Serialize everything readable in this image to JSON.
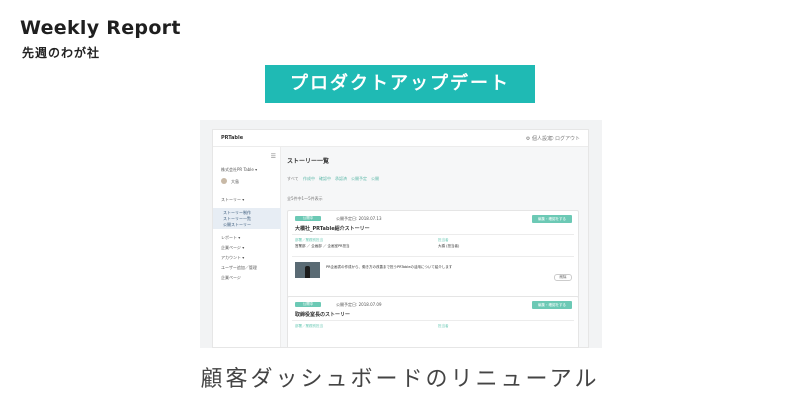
{
  "header": {
    "title": "Weekly Report",
    "subtitle": "先週のわが社"
  },
  "banner": {
    "label": "プロダクトアップデート"
  },
  "caption": "顧客ダッシュボードのリニューアル",
  "screenshot": {
    "topbar": {
      "logo": "PRTable",
      "right_items": [
        "⚙ 個人設定",
        "⎋ ログアウト"
      ]
    },
    "sidebar": {
      "company": "株式会社PR Table ▾",
      "user": "大島",
      "story_menu": "ストーリー ▾",
      "sub_items": [
        "ストーリー制作",
        "ストーリー一覧",
        "公開ストーリー"
      ],
      "items": [
        "レポート ▾",
        "企業ページ ▾",
        "アカウント ▾",
        "ユーザー追加／管理",
        "企業ページ"
      ]
    },
    "main": {
      "title": "ストーリー一覧",
      "filters": [
        "すべて",
        "作成中",
        "確認中",
        "承認済",
        "公開予定",
        "公開"
      ],
      "count": "全5件中1～5件表示",
      "cards": [
        {
          "tag": "公開中",
          "date": "公開予定日: 2018.07.13",
          "edit_label": "編集・確認をする",
          "title": "大橋社_PRTable紹介ストーリー",
          "fields": [
            {
              "label": "部署／業務別担当",
              "value": "営業部 ／ 企画部 ／ 企画室PR担当"
            },
            {
              "label": "担当者",
              "value": "大橋 (担当者)"
            }
          ],
          "description": "PR企画書の作成から、働き方の改善まで担うPRTableの活用について紹介します",
          "delete_label": "削除"
        },
        {
          "tag": "公開中",
          "date": "公開予定日: 2018.07.09",
          "edit_label": "編集・確認をする",
          "title": "取締役室長のストーリー",
          "fields": [
            {
              "label": "部署／業務別担当",
              "value": ""
            },
            {
              "label": "担当者",
              "value": ""
            }
          ]
        }
      ]
    }
  },
  "colors": {
    "accent": "#1fbab4",
    "tag_green": "#6cc9b5"
  }
}
